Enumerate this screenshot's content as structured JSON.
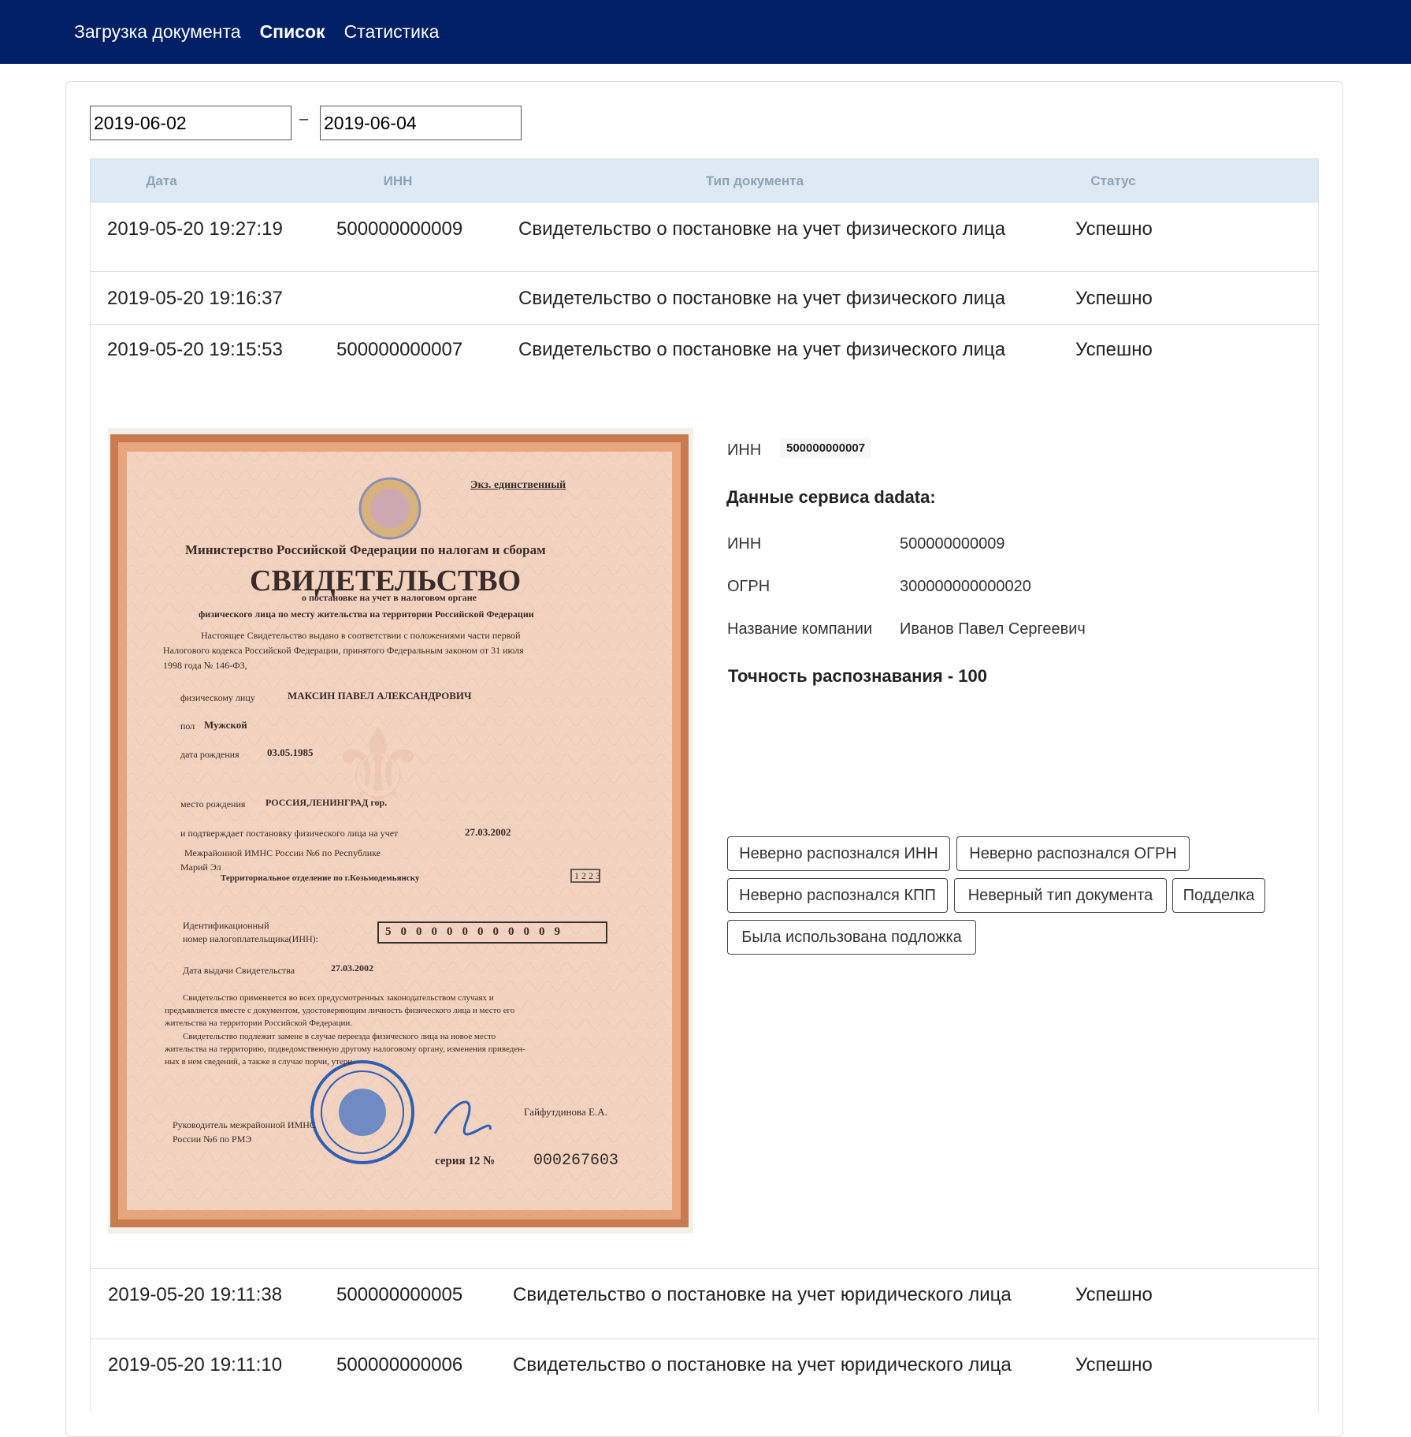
{
  "nav": {
    "items": [
      {
        "label": "Загрузка документа"
      },
      {
        "label": "Список"
      },
      {
        "label": "Статистика"
      }
    ]
  },
  "filter": {
    "date_from": "2019-06-02",
    "separator": "–",
    "date_to": "2019-06-04"
  },
  "table": {
    "columns": [
      "Дата",
      "ИНН",
      "Тип документа",
      "Статус"
    ],
    "rows": [
      {
        "date": "2019-05-20 19:27:19",
        "inn": "500000000009",
        "type": "Свидетельство о постановке на учет физического лица",
        "status": "Успешно"
      },
      {
        "date": "2019-05-20 19:16:37",
        "inn": "",
        "type": "Свидетельство о постановке на учет физического лица",
        "status": "Успешно"
      },
      {
        "date": "2019-05-20 19:15:53",
        "inn": "500000000007",
        "type": "Свидетельство о постановке на учет физического лица",
        "status": "Успешно"
      },
      {
        "date": "2019-05-20 19:11:38",
        "inn": "500000000005",
        "type": "Свидетельство о постановке на учет юридического лица",
        "status": "Успешно"
      },
      {
        "date": "2019-05-20 19:11:10",
        "inn": "500000000006",
        "type": "Свидетельство о постановке на учет юридического лица",
        "status": "Успешно"
      }
    ]
  },
  "detail": {
    "inn_label": "ИНН",
    "inn_value": "500000000007",
    "dadata_title": "Данные сервиса dadata:",
    "fields": [
      {
        "label": "ИНН",
        "value": "500000000009"
      },
      {
        "label": "ОГРН",
        "value": "300000000000020"
      },
      {
        "label": "Название компании",
        "value": "Иванов Павел Сергеевич"
      }
    ],
    "accuracy": "Точность распознавания - 100",
    "buttons": [
      "Неверно распознался ИНН",
      "Неверно распознался ОГРН",
      "Неверно распознался КПП",
      "Неверный тип документа",
      "Подделка",
      "Была использована подложка"
    ]
  },
  "document": {
    "copy_note": "Экз. единственный",
    "ministry": "Министерство Российской Федерации по налогам и сборам",
    "title": "СВИДЕТЕЛЬСТВО",
    "subtitle1": "о постановке на учет в налоговом органе",
    "subtitle2": "физического лица по месту жительства на территории Российской Федерации",
    "para1a": "Настоящее Свидетельство выдано в соответствии с положениями части первой",
    "para1b": "Налогового кодекса Российской Федерации, принятого Федеральным законом от 31 июля",
    "para1c": "1998 года № 146-ФЗ,",
    "person_label": "физическому лицу",
    "person_value": "МАКСИН ПАВЕЛ АЛЕКСАНДРОВИЧ",
    "sex_label": "пол",
    "sex_value": "Мужской",
    "birth_label": "дата рождения",
    "birth_value": "03.05.1985",
    "place_label": "место рождения",
    "place_value": "РОССИЯ,ЛЕНИНГРАД гор.",
    "confirm_label": "и подтверждает постановку физического лица на учет",
    "confirm_value": "27.03.2002",
    "authority1": "Межрайонной ИМНС России №6 по Республике",
    "authority2": "Марий Эл",
    "authority3": "Территориальное отделение по г.Козьмодемьянску",
    "authority_code": "1223",
    "inn_label1": "Идентификационный",
    "inn_label2": "номер налогоплательщика(ИНН):",
    "inn_digits": "500000000009",
    "issue_label": "Дата выдачи Свидетельства",
    "issue_value": "27.03.2002",
    "para2a": "Свидетельство применяется во всех предусмотренных законодательством случаях и",
    "para2b": "предъявляется вместе с документом, удостоверяющим личность физического лица и место его",
    "para2c": "жительства на территории Российской Федерации.",
    "para3a": "Свидетельство подлежит замене в случае переезда физического лица на новое место",
    "para3b": "жительства на территорию, подведомственную другому налоговому органу, изменения приведен-",
    "para3c": "ных в нем сведений, а также в случае порчи, утери.",
    "head1": "Руководитель межрайонной ИМНС",
    "head2": "России №6 по РМЭ",
    "signer": "Гайфутдинова Е.А.",
    "series_label": "серия 12 №",
    "series_number": "000267603"
  }
}
